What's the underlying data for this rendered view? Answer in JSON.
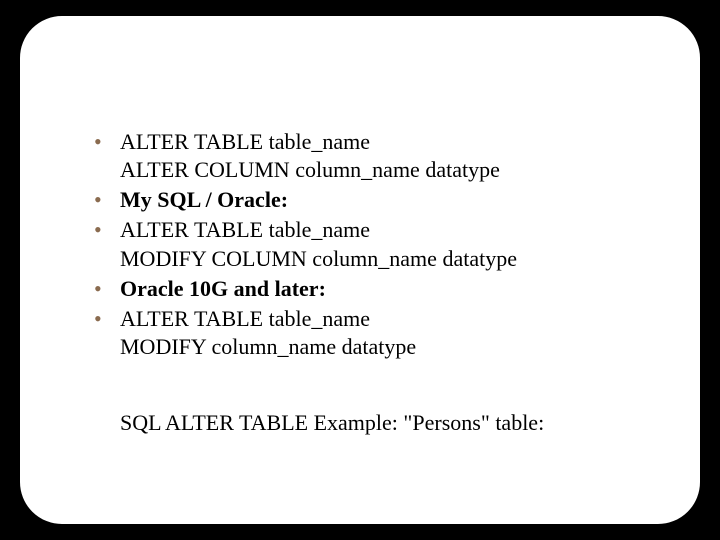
{
  "bullets": [
    {
      "line1": "ALTER TABLE table_name",
      "line2": "ALTER COLUMN column_name datatype",
      "boldLine1": false
    },
    {
      "line1": "My SQL / Oracle:",
      "line2": "",
      "boldLine1": true
    },
    {
      "line1": "ALTER TABLE table_name",
      "line2": "MODIFY COLUMN column_name datatype",
      "boldLine1": false
    },
    {
      "line1": "Oracle 10G and later:",
      "line2": "",
      "boldLine1": true
    },
    {
      "line1": "ALTER TABLE table_name",
      "line2": "MODIFY column_name datatype",
      "boldLine1": false
    }
  ],
  "footer": "SQL ALTER TABLE Example: \"Persons\" table:",
  "pageNumber": ""
}
